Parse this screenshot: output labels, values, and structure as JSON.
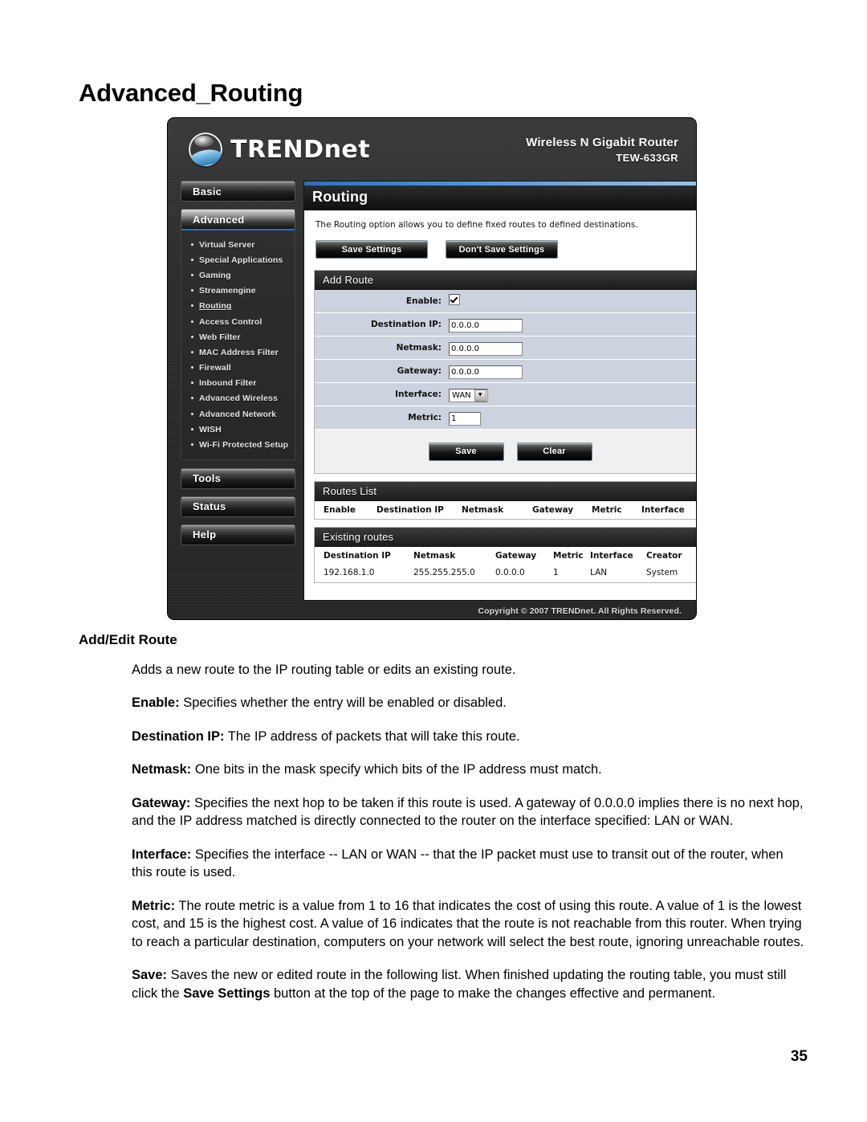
{
  "document": {
    "title": "Advanced_Routing",
    "page_number": "35"
  },
  "router_ui": {
    "brand": {
      "logo_text_main": "TREND",
      "logo_text_sub": "net",
      "product_name": "Wireless N Gigabit Router",
      "model": "TEW-633GR"
    },
    "sidebar": {
      "buttons": [
        {
          "label": "Basic",
          "active": false
        },
        {
          "label": "Advanced",
          "active": true
        }
      ],
      "submenu": [
        {
          "label": "Virtual Server",
          "current": false
        },
        {
          "label": "Special Applications",
          "current": false
        },
        {
          "label": "Gaming",
          "current": false
        },
        {
          "label": "Streamengine",
          "current": false
        },
        {
          "label": "Routing",
          "current": true
        },
        {
          "label": "Access Control",
          "current": false
        },
        {
          "label": "Web Filter",
          "current": false
        },
        {
          "label": "MAC Address Filter",
          "current": false
        },
        {
          "label": "Firewall",
          "current": false
        },
        {
          "label": "Inbound Filter",
          "current": false
        },
        {
          "label": "Advanced Wireless",
          "current": false
        },
        {
          "label": "Advanced Network",
          "current": false
        },
        {
          "label": "WISH",
          "current": false
        },
        {
          "label": "Wi-Fi Protected Setup",
          "current": false
        }
      ],
      "footer_buttons": [
        {
          "label": "Tools"
        },
        {
          "label": "Status"
        },
        {
          "label": "Help"
        }
      ]
    },
    "panel": {
      "title": "Routing",
      "description": "The Routing option allows you to define fixed routes to defined destinations.",
      "save_settings_label": "Save Settings",
      "dont_save_settings_label": "Don't Save Settings"
    },
    "add_route": {
      "section_title": "Add Route",
      "fields": {
        "enable_label": "Enable:",
        "enable_checked": true,
        "destination_ip_label": "Destination IP:",
        "destination_ip_value": "0.0.0.0",
        "netmask_label": "Netmask:",
        "netmask_value": "0.0.0.0",
        "gateway_label": "Gateway:",
        "gateway_value": "0.0.0.0",
        "interface_label": "Interface:",
        "interface_value": "WAN",
        "metric_label": "Metric:",
        "metric_value": "1"
      },
      "save_label": "Save",
      "clear_label": "Clear"
    },
    "routes_list": {
      "section_title": "Routes List",
      "columns": [
        "Enable",
        "Destination IP",
        "Netmask",
        "Gateway",
        "Metric",
        "Interface"
      ],
      "rows": []
    },
    "existing_routes": {
      "section_title": "Existing routes",
      "columns": [
        "Destination IP",
        "Netmask",
        "Gateway",
        "Metric",
        "Interface",
        "Creator"
      ],
      "rows": [
        {
          "destination_ip": "192.168.1.0",
          "netmask": "255.255.255.0",
          "gateway": "0.0.0.0",
          "metric": "1",
          "interface": "LAN",
          "creator": "System"
        }
      ]
    },
    "copyright": "Copyright © 2007 TRENDnet. All Rights Reserved."
  },
  "prose": {
    "heading": "Add/Edit Route",
    "p_intro": "Adds a new route to the IP routing table or edits an existing route.",
    "p_enable_term": "Enable:",
    "p_enable_text": " Specifies whether the entry will be enabled or disabled.",
    "p_destination_term": "Destination IP:",
    "p_destination_text": " The IP address of packets that will take this route.",
    "p_netmask_term": "Netmask:",
    "p_netmask_text": " One bits in the mask specify which bits of the IP address must match.",
    "p_gateway_term": "Gateway:",
    "p_gateway_text": " Specifies the next hop to be taken if this route is used. A gateway of 0.0.0.0 implies there is no next hop, and the IP address matched is directly connected to the router on the interface specified: LAN or WAN.",
    "p_interface_term": "Interface:",
    "p_interface_text": " Specifies the interface -- LAN or WAN -- that the IP packet must use to transit out of the router, when this route is used.",
    "p_metric_term": "Metric:",
    "p_metric_text": " The route metric is a value from 1 to 16 that indicates the cost of using this route. A value of 1 is the lowest cost, and 15 is the highest cost. A value of 16 indicates that the route is not reachable from this router. When trying to reach a particular destination, computers on your network will select the best route, ignoring unreachable routes.",
    "p_save_term": "Save:",
    "p_save_text_a": " Saves the new or edited route in the following list. When finished updating the routing table, you must still click the ",
    "p_save_emph": "Save Settings",
    "p_save_text_b": " button at the top of the page to make the changes effective and permanent."
  }
}
